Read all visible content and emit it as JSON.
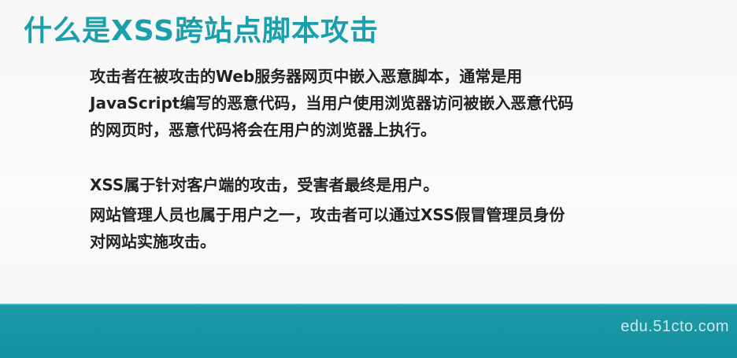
{
  "slide": {
    "title": "什么是XSS跨站点脚本攻击",
    "paragraphs": [
      {
        "lines": [
          "攻击者在被攻击的Web服务器网页中嵌入恶意脚本，通常是用",
          "JavaScript编写的恶意代码，当用户使用浏览器访问被嵌入恶意代码",
          "的网页时，恶意代码将会在用户的浏览器上执行。"
        ]
      },
      {
        "lines": [
          "XSS属于针对客户端的攻击，受害者最终是用户。"
        ]
      },
      {
        "lines": [
          "网站管理人员也属于用户之一，攻击者可以通过XSS假冒管理员身份",
          "对网站实施攻击。"
        ]
      }
    ]
  },
  "footer": {
    "watermark": "edu.51cto.com"
  },
  "colors": {
    "title": "#1aa0ac",
    "footer_band": "#1c9aa8",
    "body_text": "#222222"
  }
}
